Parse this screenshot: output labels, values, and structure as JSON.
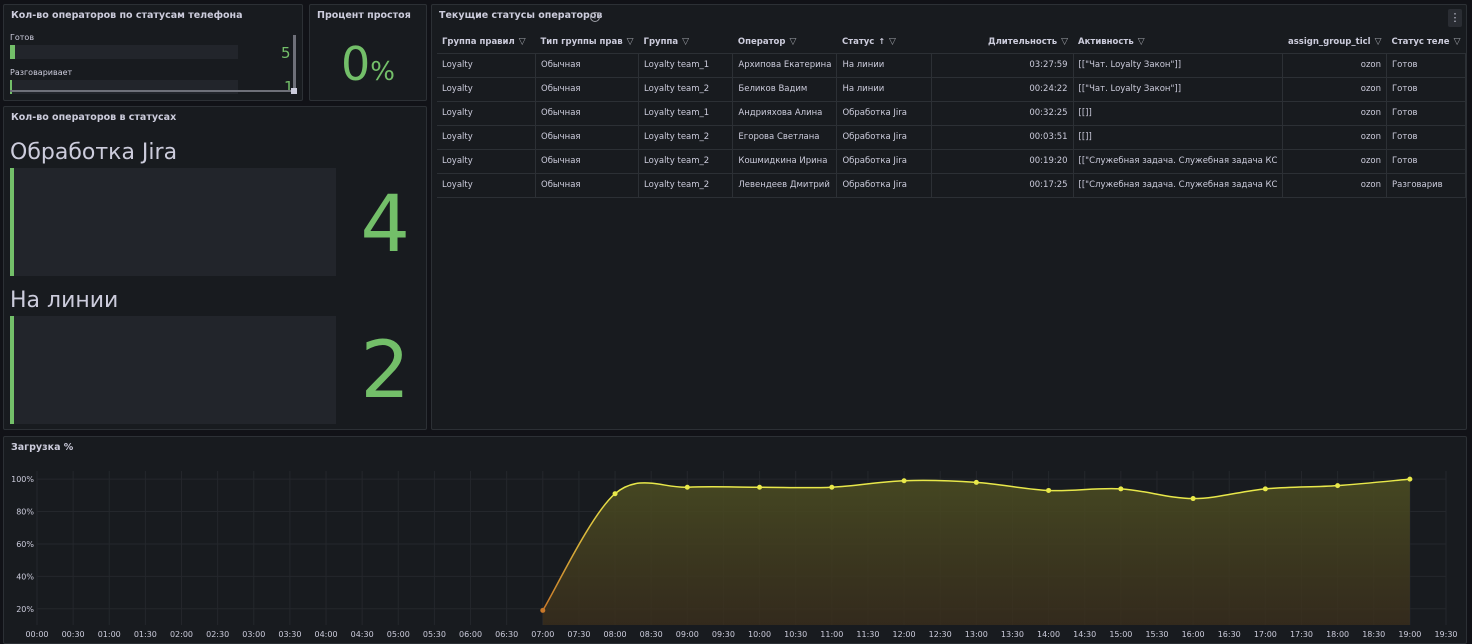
{
  "phone_panel": {
    "title": "Кол-во операторов по статусам телефона",
    "rows": [
      {
        "label": "Готов",
        "value": "5",
        "fraction": 0.02
      },
      {
        "label": "Разговаривает",
        "value": "1",
        "fraction": 0.005
      }
    ]
  },
  "idle_panel": {
    "title": "Процент простоя",
    "value": "0",
    "unit": "%"
  },
  "status_panel": {
    "title": "Кол-во операторов в статусах",
    "items": [
      {
        "name": "Обработка Jira",
        "value": "4"
      },
      {
        "name": "На линии",
        "value": "2"
      }
    ]
  },
  "table_panel": {
    "title": "Текущие статусы операторов",
    "info_icon": "info-icon",
    "menu_icon": "⋮",
    "columns": [
      "Группа правил",
      "Тип группы прав",
      "Группа",
      "Оператор",
      "Статус",
      "Длительность",
      "Активность",
      "assign_group_ticl",
      "Статус теле"
    ],
    "sorted_column": "Статус",
    "rows": [
      [
        "Loyalty",
        "Обычная",
        "Loyalty team_1",
        "Архипова Екатерина",
        "На линии",
        "03:27:59",
        "[[\"Чат. Loyalty Закон\"]]",
        "ozon",
        "Готов"
      ],
      [
        "Loyalty",
        "Обычная",
        "Loyalty team_2",
        "Беликов Вадим",
        "На линии",
        "00:24:22",
        "[[\"Чат. Loyalty Закон\"]]",
        "ozon",
        "Готов"
      ],
      [
        "Loyalty",
        "Обычная",
        "Loyalty team_1",
        "Андрияхова Алина",
        "Обработка Jira",
        "00:32:25",
        "[[]]",
        "ozon",
        "Готов"
      ],
      [
        "Loyalty",
        "Обычная",
        "Loyalty team_2",
        "Егорова Светлана",
        "Обработка Jira",
        "00:03:51",
        "[[]]",
        "ozon",
        "Готов"
      ],
      [
        "Loyalty",
        "Обычная",
        "Loyalty team_2",
        "Кошмидкина Ирина",
        "Обработка Jira",
        "00:19:20",
        "[[\"Служебная задача. Служебная задача КС",
        "ozon",
        "Готов"
      ],
      [
        "Loyalty",
        "Обычная",
        "Loyalty team_2",
        "Левендеев Дмитрий",
        "Обработка Jira",
        "00:17:25",
        "[[\"Служебная задача. Служебная задача КС",
        "ozon",
        "Разговарив"
      ]
    ]
  },
  "chart_panel": {
    "title": "Загрузка %"
  },
  "chart_data": {
    "type": "area",
    "title": "Загрузка %",
    "xlabel": "",
    "ylabel": "",
    "y_ticks": [
      "20%",
      "40%",
      "60%",
      "80%",
      "100%"
    ],
    "x_ticks": [
      "00:00",
      "00:30",
      "01:00",
      "01:30",
      "02:00",
      "02:30",
      "03:00",
      "03:30",
      "04:00",
      "04:30",
      "05:00",
      "05:30",
      "06:00",
      "06:30",
      "07:00",
      "07:30",
      "08:00",
      "08:30",
      "09:00",
      "09:30",
      "10:00",
      "10:30",
      "11:00",
      "11:30",
      "12:00",
      "12:30",
      "13:00",
      "13:30",
      "14:00",
      "14:30",
      "15:00",
      "15:30",
      "16:00",
      "16:30",
      "17:00",
      "17:30",
      "18:00",
      "18:30",
      "19:00",
      "19:30"
    ],
    "x": [
      "07:00",
      "08:00",
      "09:00",
      "10:00",
      "11:00",
      "12:00",
      "13:00",
      "14:00",
      "15:00",
      "16:00",
      "17:00",
      "18:00",
      "19:00"
    ],
    "series": [
      {
        "values": [
          19,
          91,
          95,
          95,
          95,
          99,
          98,
          93,
          94,
          88,
          94,
          96,
          100
        ]
      }
    ],
    "ylim": [
      10,
      105
    ],
    "grid": true,
    "colors": {
      "line": "#e8e84a",
      "start": "#c8782a",
      "fill": "#3b3c1f"
    }
  }
}
